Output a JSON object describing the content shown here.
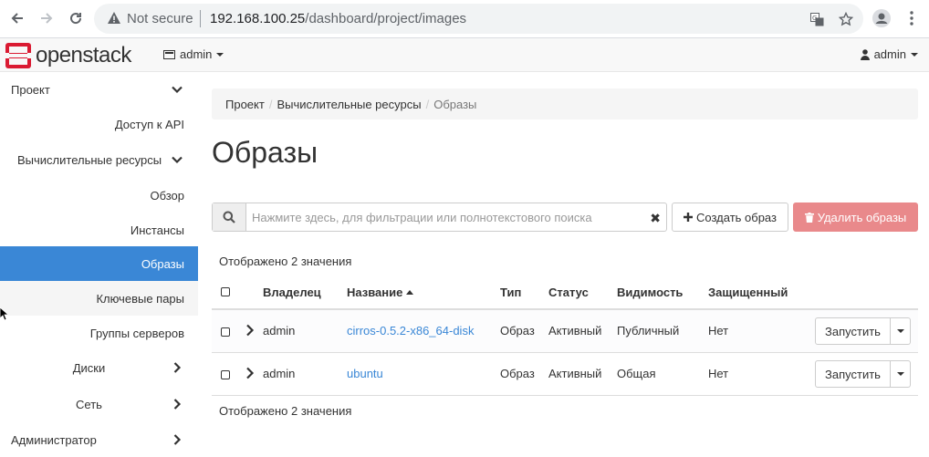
{
  "browser": {
    "not_secure": "Not secure",
    "url_host": "192.168.100.25",
    "url_path": "/dashboard/project/images"
  },
  "header": {
    "logo_text": "openstack",
    "project": "admin",
    "user": "admin"
  },
  "sidebar": {
    "items": [
      {
        "label": "Проект"
      },
      {
        "label": "Доступ к API"
      },
      {
        "label": "Вычислительные ресурсы"
      },
      {
        "label": "Обзор"
      },
      {
        "label": "Инстансы"
      },
      {
        "label": "Образы"
      },
      {
        "label": "Ключевые пары"
      },
      {
        "label": "Группы серверов"
      },
      {
        "label": "Диски"
      },
      {
        "label": "Сеть"
      },
      {
        "label": "Администратор"
      }
    ]
  },
  "breadcrumb": {
    "items": [
      "Проект",
      "Вычислительные ресурсы",
      "Образы"
    ]
  },
  "page_title": "Образы",
  "filter": {
    "placeholder": "Нажмите здесь, для фильтрации или полнотекстового поиска"
  },
  "buttons": {
    "create": "Создать образ",
    "delete": "Удалить образы"
  },
  "count_text": "Отображено 2 значения",
  "table": {
    "headers": [
      "Владелец",
      "Название",
      "Тип",
      "Статус",
      "Видимость",
      "Защищенный"
    ],
    "rows": [
      {
        "owner": "admin",
        "name": "cirros-0.5.2-x86_64-disk",
        "type": "Образ",
        "status": "Активный",
        "visibility": "Публичный",
        "protected": "Нет",
        "action": "Запустить"
      },
      {
        "owner": "admin",
        "name": "ubuntu",
        "type": "Образ",
        "status": "Активный",
        "visibility": "Общая",
        "protected": "Нет",
        "action": "Запустить"
      }
    ]
  },
  "colors": {
    "accent": "#3a87d6",
    "danger": "#e9898b",
    "brand": "#da1a32"
  }
}
